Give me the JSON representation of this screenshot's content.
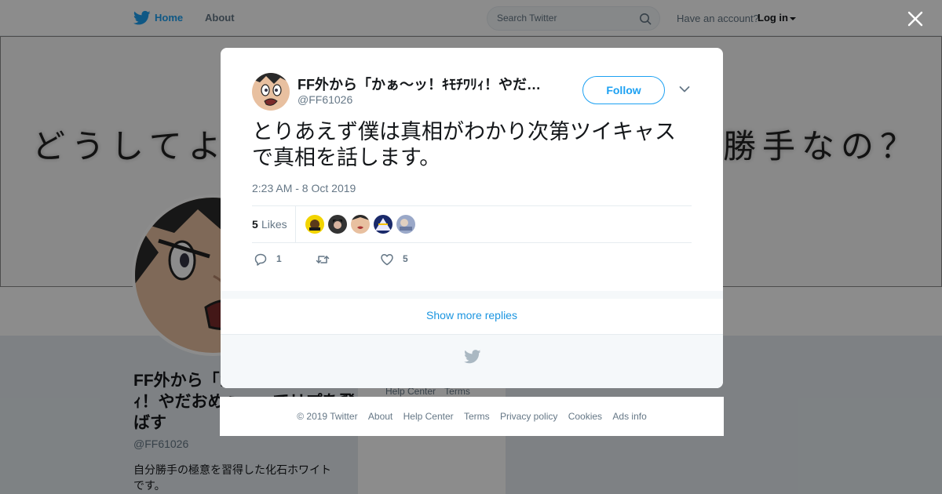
{
  "nav": {
    "home_label": "Home",
    "about_label": "About",
    "search_placeholder": "Search Twitter",
    "have_account": "Have an account?",
    "login_label": "Log in"
  },
  "banner": {
    "text_left": "どうしてよ",
    "text_right": "勝手なの？"
  },
  "profile": {
    "name": "FF外から「かぁ〜ッ！ｷﾓﾁﾜﾘｨ！やだおめぇ」ってリプを飛ばす",
    "handle": "@FF61026",
    "bio": "自分勝手の極意を習得した化石ホワイトです。",
    "side_links": [
      "Help Center",
      "Terms"
    ]
  },
  "tweet": {
    "author_name": "FF外から「かぁ〜ッ！ｷﾓﾁﾜﾘｨ！やだおめぇ」ってリプを飛ばす",
    "author_handle": "@FF61026",
    "follow_label": "Follow",
    "text": "とりあえず僕は真相がわかり次第ツイキャスで真相を話します。",
    "timestamp": "2:23 AM - 8 Oct 2019",
    "likes_count": "5",
    "likes_label": "Likes",
    "reply_count": "1",
    "retweet_count": "",
    "like_count": "5",
    "show_more": "Show more replies"
  },
  "footer": {
    "items": [
      "© 2019 Twitter",
      "About",
      "Help Center",
      "Terms",
      "Privacy policy",
      "Cookies",
      "Ads info"
    ]
  },
  "colors": {
    "accent": "#1da1f2",
    "link": "#1b95e0",
    "secondary_text": "#657786",
    "border": "#e6ecf0"
  },
  "icons": [
    "twitter-bird-icon",
    "search-icon",
    "close-icon",
    "chevron-down-icon",
    "reply-icon",
    "retweet-icon",
    "heart-icon"
  ]
}
